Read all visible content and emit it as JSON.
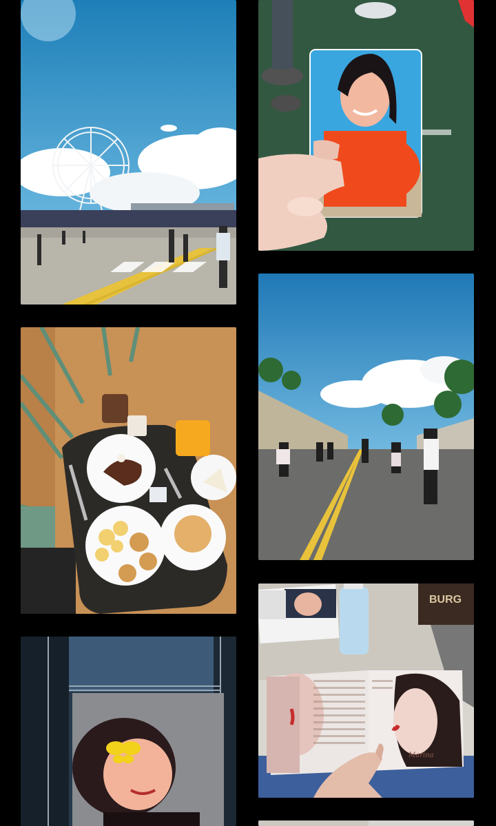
{
  "gallery": {
    "photos": [
      {
        "subject": "ferris-wheel",
        "column": "left",
        "row": 1
      },
      {
        "subject": "photocard-in-hand",
        "column": "right",
        "row": 1
      },
      {
        "subject": "breakfast-tray",
        "column": "left",
        "row": 2
      },
      {
        "subject": "crowd-walking-on-road",
        "column": "right",
        "row": 2
      },
      {
        "subject": "stage-screen",
        "column": "left",
        "row": 3
      },
      {
        "subject": "album-booklet",
        "column": "right",
        "row": 3
      },
      {
        "subject": "partial-photo",
        "column": "right",
        "row": 4
      }
    ],
    "visible_text": {
      "bag_lettering": "BURG",
      "booklet_signature": "Marina"
    }
  },
  "colors": {
    "background": "#000000",
    "sky": "#3b9ad0",
    "cloud": "#ffffff",
    "dress": "#f04a1c",
    "card_blue": "#3aa6e0",
    "butterfly": "#f2d21a",
    "table_wood": "#c89156",
    "road": "#6c6c6a",
    "lane_yellow": "#e8c23a"
  }
}
